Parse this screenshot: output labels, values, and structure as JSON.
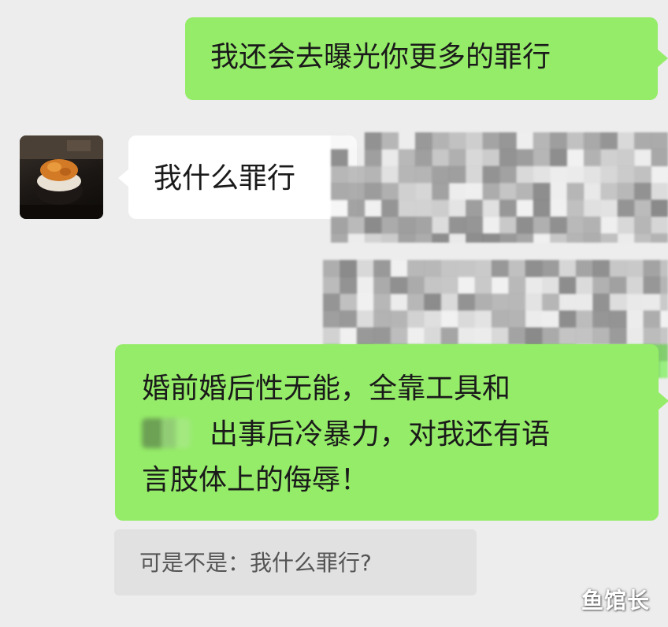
{
  "chat": {
    "messages": [
      {
        "sender": "self",
        "text": "我还会去曝光你更多的罪行"
      },
      {
        "sender": "other",
        "text": "我什么罪行"
      },
      {
        "sender": "self",
        "lines": [
          "婚前婚后性无能，全靠工具和",
          "出事后冷暴力，对我还有语",
          "言肢体上的侮辱！"
        ]
      }
    ],
    "quoted_reply": "可是不是：我什么罪行?"
  },
  "redactions": [
    "pixelated-text-1",
    "pixelated-text-2"
  ],
  "watermark": "鱼馆长",
  "colors": {
    "background": "#ededed",
    "self_bubble": "#95ec69",
    "other_bubble": "#ffffff",
    "quote_bg": "#e1e1e1"
  }
}
